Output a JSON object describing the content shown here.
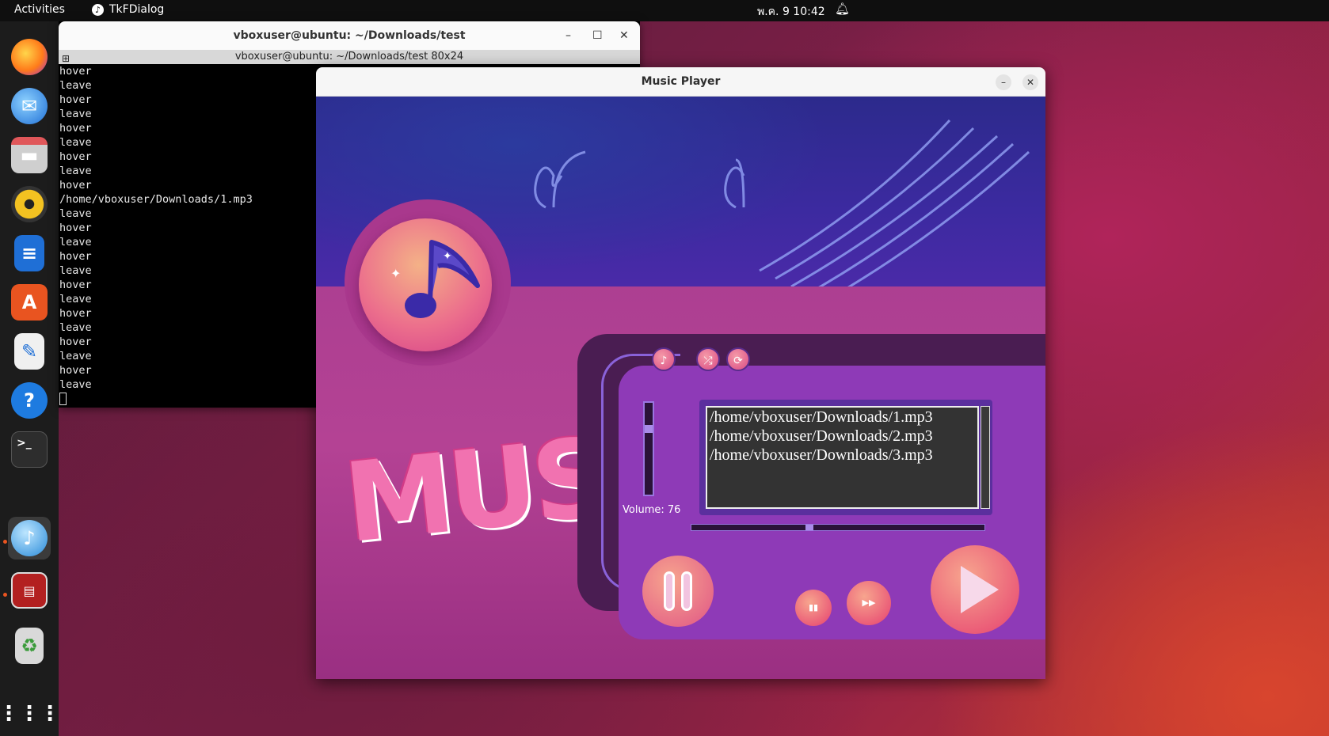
{
  "topbar": {
    "activities": "Activities",
    "app_name": "TkFDialog",
    "clock": "พ.ค. 9  10:42"
  },
  "dock": {
    "items": [
      "firefox",
      "thunderbird",
      "files",
      "rhythmbox",
      "libreoffice-writer",
      "app-center",
      "text-editor",
      "help",
      "terminal",
      "music-player",
      "tk-app",
      "trash",
      "show-apps"
    ]
  },
  "terminal": {
    "title": "vboxuser@ubuntu: ~/Downloads/test",
    "subtitle": "vboxuser@ubuntu: ~/Downloads/test 80x24",
    "lines": [
      "hover",
      "leave",
      "hover",
      "leave",
      "hover",
      "leave",
      "hover",
      "leave",
      "hover",
      "/home/vboxuser/Downloads/1.mp3",
      "leave",
      "hover",
      "leave",
      "hover",
      "leave",
      "hover",
      "leave",
      "hover",
      "leave",
      "hover",
      "leave",
      "hover",
      "leave"
    ]
  },
  "player": {
    "title": "Music Player",
    "playlist": [
      "/home/vboxuser/Downloads/1.mp3",
      "/home/vboxuser/Downloads/2.mp3",
      "/home/vboxuser/Downloads/3.mp3"
    ],
    "volume_label": "Volume: 76",
    "volume": 76,
    "art_text": "MUSIC"
  },
  "colors": {
    "accent": "#e95420",
    "player_panel": "#8e3ab7",
    "play_button": "#e6406f"
  }
}
